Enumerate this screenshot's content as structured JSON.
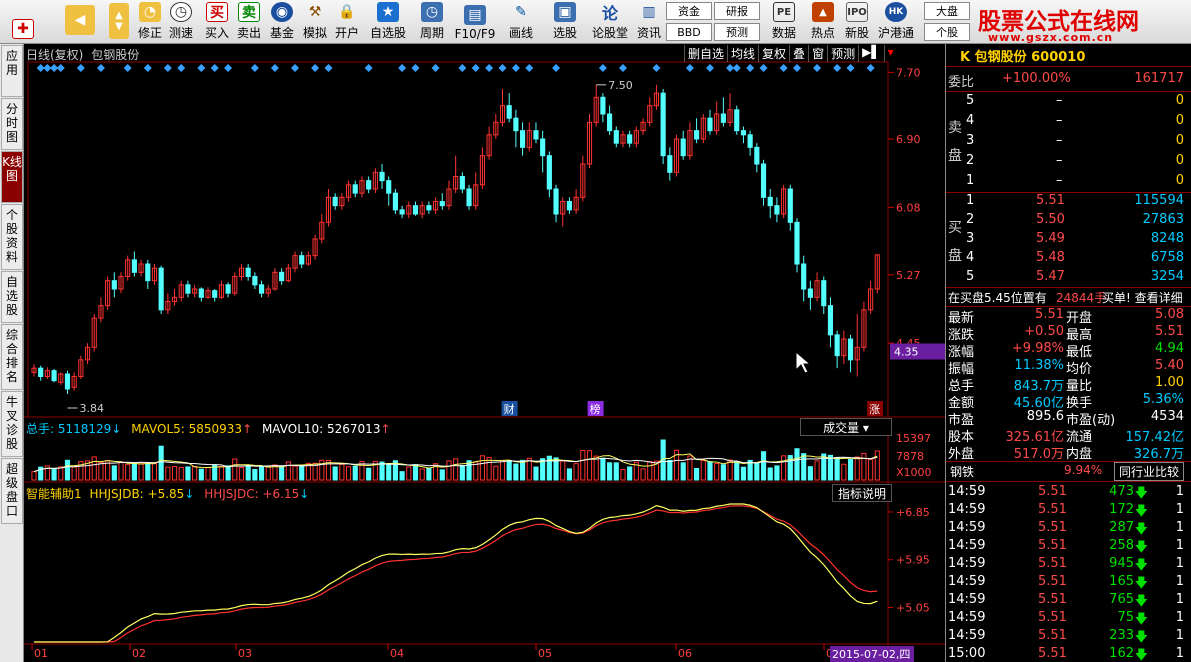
{
  "toolbar": {
    "buttons": [
      "修正",
      "测速",
      "买入",
      "卖出",
      "基金",
      "模拟",
      "开户",
      "自选股",
      "周期",
      "F10/F9",
      "画线",
      "选股",
      "论股堂",
      "资讯",
      "数据",
      "热点",
      "新股",
      "沪港通",
      "个股"
    ],
    "small_buttons": [
      "资金",
      "BBD",
      "研报",
      "预测",
      "大盘"
    ],
    "brand": "股票公式在线网",
    "brand_url": "www.gszx.com.cn"
  },
  "left_tabs": [
    "应用",
    "分时图",
    "K线图",
    "个股资料",
    "自选股",
    "综合排名",
    "牛叉诊股",
    "超级盘口"
  ],
  "chart": {
    "title": "日线(复权)",
    "stock": "包钢股份",
    "tools": [
      "删自选",
      "均线",
      "复权",
      "叠",
      "窗",
      "预测"
    ],
    "high_label": "7.50",
    "low_label": "3.84",
    "price_axis": [
      "7.70",
      "6.90",
      "6.08",
      "5.27",
      "4.45"
    ],
    "current_price_tag": "4.35",
    "event_labels": [
      "财",
      "榜",
      "涨"
    ],
    "vol_legend": {
      "total": "总手: 5118129",
      "mavol5": "MAVOL5: 5850933",
      "mavol10": "MAVOL10: 5267013"
    },
    "vol_select": "成交量",
    "vol_axis": [
      "15397",
      "7878",
      "X1000"
    ],
    "ind_legend": {
      "name": "智能辅助1",
      "a": "HHJSJDB: +5.85",
      "b": "HHJSJDC: +6.15"
    },
    "ind_button": "指标说明",
    "ind_axis": [
      "+6.85",
      "+5.95",
      "+5.05"
    ],
    "date_axis": [
      "01",
      "02",
      "03",
      "04",
      "05",
      "06",
      "0"
    ],
    "date_tag": "2015-07-02,四",
    "colors": {
      "up": "#ff3232",
      "down": "#54ffff",
      "diamond": "#3aa0ff"
    }
  },
  "chart_data": {
    "type": "candlestick",
    "title": "日线(复权) 包钢股份",
    "ylim": [
      3.6,
      7.8
    ],
    "candles": [
      [
        4.1,
        4.15,
        4.2,
        4.05
      ],
      [
        4.15,
        4.05,
        4.18,
        4.0
      ],
      [
        4.05,
        4.12,
        4.16,
        4.02
      ],
      [
        4.12,
        4.0,
        4.14,
        3.98
      ],
      [
        3.98,
        4.08,
        4.1,
        3.95
      ],
      [
        4.08,
        3.9,
        4.12,
        3.84
      ],
      [
        3.92,
        4.05,
        4.1,
        3.88
      ],
      [
        4.05,
        4.25,
        4.3,
        4.02
      ],
      [
        4.25,
        4.4,
        4.45,
        4.2
      ],
      [
        4.4,
        4.75,
        4.8,
        4.35
      ],
      [
        4.75,
        4.9,
        5.0,
        4.7
      ],
      [
        4.9,
        5.2,
        5.25,
        4.85
      ],
      [
        5.2,
        5.1,
        5.3,
        5.0
      ],
      [
        5.1,
        5.25,
        5.3,
        5.05
      ],
      [
        5.25,
        5.45,
        5.5,
        5.2
      ],
      [
        5.45,
        5.3,
        5.55,
        5.25
      ],
      [
        5.3,
        5.4,
        5.45,
        5.25
      ],
      [
        5.4,
        5.2,
        5.45,
        5.1
      ],
      [
        5.2,
        5.35,
        5.4,
        5.15
      ],
      [
        5.35,
        4.85,
        5.38,
        4.8
      ],
      [
        4.85,
        4.95,
        5.05,
        4.8
      ],
      [
        4.95,
        5.0,
        5.1,
        4.9
      ],
      [
        5.0,
        5.15,
        5.2,
        4.95
      ],
      [
        5.15,
        5.05,
        5.2,
        5.0
      ],
      [
        5.05,
        5.1,
        5.15,
        5.0
      ],
      [
        5.1,
        5.0,
        5.12,
        4.95
      ],
      [
        5.0,
        5.08,
        5.12,
        4.98
      ],
      [
        5.08,
        5.0,
        5.1,
        4.95
      ],
      [
        5.0,
        5.15,
        5.2,
        4.98
      ],
      [
        5.15,
        5.05,
        5.18,
        5.0
      ],
      [
        5.05,
        5.25,
        5.3,
        5.02
      ],
      [
        5.25,
        5.35,
        5.4,
        5.2
      ],
      [
        5.35,
        5.25,
        5.4,
        5.2
      ],
      [
        5.25,
        5.15,
        5.3,
        5.1
      ],
      [
        5.15,
        5.05,
        5.2,
        5.0
      ],
      [
        5.05,
        5.1,
        5.15,
        5.0
      ],
      [
        5.1,
        5.3,
        5.35,
        5.08
      ],
      [
        5.3,
        5.2,
        5.35,
        5.15
      ],
      [
        5.2,
        5.35,
        5.4,
        5.18
      ],
      [
        5.35,
        5.5,
        5.55,
        5.3
      ],
      [
        5.5,
        5.4,
        5.55,
        5.35
      ],
      [
        5.4,
        5.5,
        5.55,
        5.38
      ],
      [
        5.5,
        5.7,
        5.75,
        5.45
      ],
      [
        5.7,
        5.9,
        6.0,
        5.65
      ],
      [
        5.9,
        6.2,
        6.3,
        5.85
      ],
      [
        6.2,
        6.1,
        6.25,
        6.05
      ],
      [
        6.1,
        6.2,
        6.25,
        6.05
      ],
      [
        6.2,
        6.35,
        6.4,
        6.15
      ],
      [
        6.35,
        6.25,
        6.4,
        6.2
      ],
      [
        6.25,
        6.4,
        6.45,
        6.2
      ],
      [
        6.4,
        6.3,
        6.45,
        6.25
      ],
      [
        6.3,
        6.5,
        6.55,
        6.25
      ],
      [
        6.5,
        6.4,
        6.6,
        6.3
      ],
      [
        6.4,
        6.25,
        6.45,
        6.1
      ],
      [
        6.25,
        6.05,
        6.3,
        6.0
      ],
      [
        6.05,
        6.0,
        6.1,
        5.95
      ],
      [
        6.0,
        6.1,
        6.15,
        5.95
      ],
      [
        6.1,
        6.0,
        6.15,
        5.98
      ],
      [
        6.0,
        6.1,
        6.15,
        5.95
      ],
      [
        6.1,
        6.05,
        6.15,
        6.0
      ],
      [
        6.05,
        6.15,
        6.2,
        6.0
      ],
      [
        6.15,
        6.1,
        6.25,
        6.05
      ],
      [
        6.1,
        6.3,
        6.4,
        6.05
      ],
      [
        6.3,
        6.45,
        6.7,
        6.25
      ],
      [
        6.45,
        6.3,
        6.5,
        6.25
      ],
      [
        6.3,
        6.1,
        6.35,
        6.05
      ],
      [
        6.1,
        6.35,
        6.5,
        6.05
      ],
      [
        6.35,
        6.7,
        6.8,
        6.3
      ],
      [
        6.7,
        6.95,
        7.05,
        6.65
      ],
      [
        6.95,
        7.1,
        7.2,
        6.9
      ],
      [
        7.1,
        7.3,
        7.5,
        7.05
      ],
      [
        7.3,
        7.15,
        7.45,
        7.1
      ],
      [
        7.15,
        7.0,
        7.25,
        6.8
      ],
      [
        7.0,
        6.8,
        7.1,
        6.7
      ],
      [
        6.8,
        7.0,
        7.1,
        6.75
      ],
      [
        7.0,
        6.9,
        7.1,
        6.85
      ],
      [
        6.9,
        6.7,
        7.0,
        6.5
      ],
      [
        6.7,
        6.3,
        6.75,
        6.2
      ],
      [
        6.3,
        6.0,
        6.35,
        5.9
      ],
      [
        6.0,
        6.15,
        6.2,
        5.85
      ],
      [
        6.15,
        6.05,
        6.2,
        6.0
      ],
      [
        6.05,
        6.2,
        6.3,
        6.0
      ],
      [
        6.2,
        6.6,
        6.7,
        6.15
      ],
      [
        6.6,
        7.1,
        7.2,
        6.55
      ],
      [
        7.1,
        7.4,
        7.55,
        7.05
      ],
      [
        7.4,
        7.2,
        7.45,
        7.1
      ],
      [
        7.2,
        7.0,
        7.3,
        6.95
      ],
      [
        7.0,
        6.85,
        7.05,
        6.8
      ],
      [
        6.85,
        6.95,
        7.0,
        6.8
      ],
      [
        6.95,
        6.85,
        7.0,
        6.8
      ],
      [
        6.85,
        7.0,
        7.05,
        6.8
      ],
      [
        7.0,
        7.1,
        7.15,
        6.95
      ],
      [
        7.1,
        7.3,
        7.4,
        7.05
      ],
      [
        7.3,
        7.45,
        7.55,
        7.25
      ],
      [
        7.45,
        6.7,
        7.5,
        6.6
      ],
      [
        6.7,
        6.5,
        6.8,
        6.4
      ],
      [
        6.5,
        6.9,
        6.95,
        6.45
      ],
      [
        6.9,
        6.7,
        7.0,
        6.65
      ],
      [
        6.7,
        7.0,
        7.1,
        6.65
      ],
      [
        7.0,
        6.9,
        7.15,
        6.85
      ],
      [
        6.9,
        7.15,
        7.2,
        6.85
      ],
      [
        7.15,
        7.0,
        7.25,
        6.95
      ],
      [
        7.0,
        7.2,
        7.35,
        6.95
      ],
      [
        7.2,
        7.1,
        7.4,
        7.05
      ],
      [
        7.1,
        7.25,
        7.45,
        7.05
      ],
      [
        7.25,
        7.0,
        7.3,
        6.95
      ],
      [
        7.0,
        6.95,
        7.05,
        6.85
      ],
      [
        6.95,
        6.8,
        7.0,
        6.7
      ],
      [
        6.8,
        6.6,
        6.85,
        6.5
      ],
      [
        6.6,
        6.2,
        6.65,
        6.1
      ],
      [
        6.2,
        6.1,
        6.3,
        5.95
      ],
      [
        6.1,
        6.0,
        6.2,
        5.9
      ],
      [
        6.0,
        6.3,
        6.35,
        5.95
      ],
      [
        6.3,
        5.9,
        6.35,
        5.8
      ],
      [
        5.9,
        5.4,
        5.95,
        5.3
      ],
      [
        5.4,
        5.1,
        5.5,
        4.95
      ],
      [
        5.1,
        5.0,
        5.2,
        4.85
      ],
      [
        5.0,
        5.2,
        5.3,
        4.95
      ],
      [
        5.2,
        4.9,
        5.25,
        4.8
      ],
      [
        4.9,
        4.55,
        5.0,
        4.4
      ],
      [
        4.55,
        4.3,
        4.6,
        4.15
      ],
      [
        4.3,
        4.5,
        4.6,
        4.2
      ],
      [
        4.5,
        4.25,
        4.55,
        4.1
      ],
      [
        4.25,
        4.4,
        4.8,
        4.05
      ],
      [
        4.4,
        4.85,
        4.95,
        4.35
      ],
      [
        4.85,
        5.1,
        5.2,
        4.8
      ],
      [
        5.1,
        5.51,
        5.51,
        5.05
      ]
    ],
    "volume_ylim": [
      0,
      15397
    ],
    "indicator": {
      "series": [
        {
          "name": "HHJSJDB",
          "color": "#ffff60"
        },
        {
          "name": "HHJSJDC",
          "color": "#ff3030"
        }
      ],
      "ylim": [
        4.4,
        7.0
      ]
    }
  },
  "quote": {
    "title": "K 包钢股份 600010",
    "weibi_label": "委比",
    "weibi_value": "+100.00%",
    "weibi_count": "161717",
    "sell_label": [
      "卖",
      "盘"
    ],
    "buy_label": [
      "买",
      "盘"
    ],
    "sell": [
      {
        "n": "5",
        "p": "–",
        "v": "0"
      },
      {
        "n": "4",
        "p": "–",
        "v": "0"
      },
      {
        "n": "3",
        "p": "–",
        "v": "0"
      },
      {
        "n": "2",
        "p": "–",
        "v": "0"
      },
      {
        "n": "1",
        "p": "–",
        "v": "0"
      }
    ],
    "buy": [
      {
        "n": "1",
        "p": "5.51",
        "v": "115594"
      },
      {
        "n": "2",
        "p": "5.50",
        "v": "27863"
      },
      {
        "n": "3",
        "p": "5.49",
        "v": "8248"
      },
      {
        "n": "4",
        "p": "5.48",
        "v": "6758"
      },
      {
        "n": "5",
        "p": "5.47",
        "v": "3254"
      }
    ],
    "info_line": {
      "a": "在买盘5.45位置有",
      "b": "24844手",
      "c": "买单! 查看详细"
    },
    "stats": [
      {
        "l1": "最新",
        "v1": "5.51",
        "l2": "开盘",
        "v2": "5.08"
      },
      {
        "l1": "涨跌",
        "v1": "+0.50",
        "l2": "最高",
        "v2": "5.51"
      },
      {
        "l1": "涨幅",
        "v1": "+9.98%",
        "l2": "最低",
        "v2": "4.94"
      },
      {
        "l1": "振幅",
        "v1": "11.38%",
        "l2": "均价",
        "v2": "5.40"
      },
      {
        "l1": "总手",
        "v1": "843.7万",
        "l2": "量比",
        "v2": "1.00"
      },
      {
        "l1": "金额",
        "v1": "45.60亿",
        "l2": "换手",
        "v2": "5.36%"
      },
      {
        "l1": "市盈",
        "v1": "895.6",
        "l2": "市盈(动)",
        "v2": "4534"
      },
      {
        "l1": "股本",
        "v1": "325.61亿",
        "l2": "流通",
        "v2": "157.42亿"
      },
      {
        "l1": "外盘",
        "v1": "517.0万",
        "l2": "内盘",
        "v2": "326.7万"
      }
    ],
    "sector": {
      "name": "钢铁",
      "pct": "9.94%",
      "button": "同行业比较"
    },
    "ticks": [
      {
        "t": "14:59",
        "p": "5.51",
        "v": "473",
        "n": "1"
      },
      {
        "t": "14:59",
        "p": "5.51",
        "v": "172",
        "n": "1"
      },
      {
        "t": "14:59",
        "p": "5.51",
        "v": "287",
        "n": "1"
      },
      {
        "t": "14:59",
        "p": "5.51",
        "v": "258",
        "n": "1"
      },
      {
        "t": "14:59",
        "p": "5.51",
        "v": "945",
        "n": "1"
      },
      {
        "t": "14:59",
        "p": "5.51",
        "v": "165",
        "n": "1"
      },
      {
        "t": "14:59",
        "p": "5.51",
        "v": "765",
        "n": "1"
      },
      {
        "t": "14:59",
        "p": "5.51",
        "v": "75",
        "n": "1"
      },
      {
        "t": "14:59",
        "p": "5.51",
        "v": "233",
        "n": "1"
      },
      {
        "t": "15:00",
        "p": "5.51",
        "v": "162",
        "n": "1"
      }
    ]
  }
}
